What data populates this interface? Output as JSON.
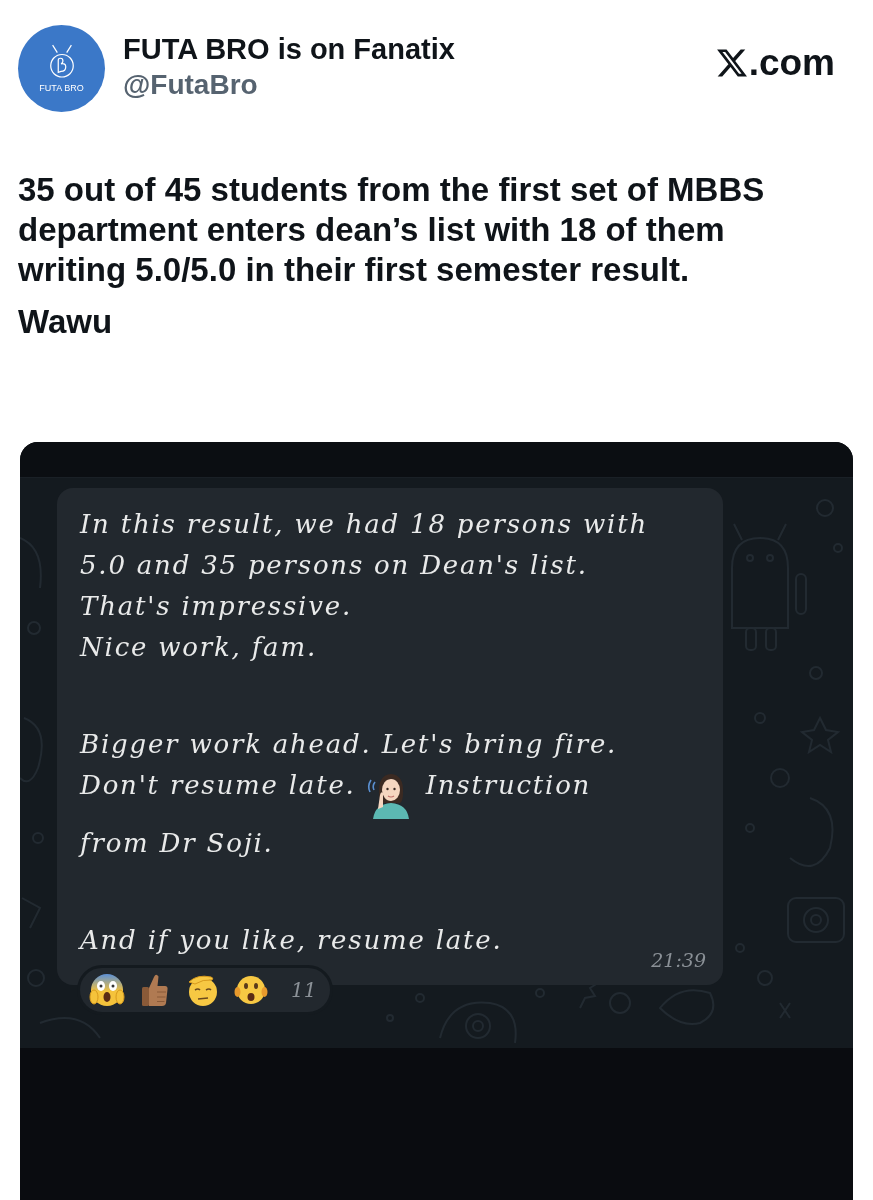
{
  "header": {
    "avatar": {
      "caption": "FUTA BRO"
    },
    "display_name": "FUTA BRO is on Fanatix",
    "handle": "@FutaBro",
    "site_label": ".com"
  },
  "tweet": {
    "paragraphs": [
      "35 out of 45 students from the first set of MBBS department enters dean’s list with 18 of them writing 5.0/5.0 in their first semester result.",
      "Wawu"
    ]
  },
  "chat_screenshot": {
    "message": {
      "paragraphs": [
        {
          "lines": [
            {
              "kind": "text",
              "text": "In this result, we had 18 persons with"
            },
            {
              "kind": "text",
              "text": "5.0 and 35 persons on Dean's list."
            },
            {
              "kind": "text",
              "text": "That's impressive."
            },
            {
              "kind": "text",
              "text": "Nice work, fam."
            }
          ]
        },
        {
          "lines": [
            {
              "kind": "text",
              "text": "Bigger work ahead. Let's bring fire."
            },
            {
              "kind": "emoji",
              "before": "Don't resume late.",
              "after": "Instruction"
            },
            {
              "kind": "text",
              "text": "from Dr Soji."
            }
          ]
        },
        {
          "lines": [
            {
              "kind": "text",
              "text": "And if you like, resume late."
            }
          ]
        }
      ],
      "time": "21:39"
    },
    "reactions": {
      "count": "11"
    }
  }
}
